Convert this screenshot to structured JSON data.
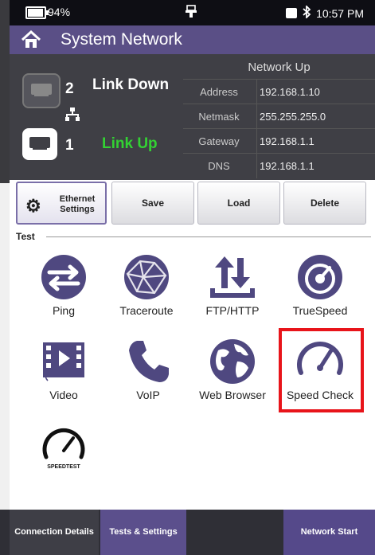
{
  "status_bar": {
    "battery_percent": "94%",
    "battery_level": 0.94,
    "time": "10:57 PM"
  },
  "titlebar": {
    "title": "System Network"
  },
  "ports": [
    {
      "number": "2",
      "status": "Link Down",
      "status_color": "#ffffff"
    },
    {
      "number": "1",
      "status": "Link Up",
      "status_color": "#33d133"
    }
  ],
  "network": {
    "header": "Network Up",
    "rows": [
      {
        "key": "Address",
        "value": "192.168.1.10"
      },
      {
        "key": "Netmask",
        "value": "255.255.255.0"
      },
      {
        "key": "Gateway",
        "value": "192.168.1.1"
      },
      {
        "key": "DNS",
        "value": "192.168.1.1"
      }
    ]
  },
  "buttons": {
    "ethernet_settings": "Ethernet Settings",
    "save": "Save",
    "load": "Load",
    "delete": "Delete"
  },
  "test_section": {
    "label": "Test"
  },
  "tests": [
    {
      "label": "Ping",
      "icon": "ping-icon"
    },
    {
      "label": "Traceroute",
      "icon": "traceroute-icon"
    },
    {
      "label": "FTP/HTTP",
      "icon": "ftp-http-icon"
    },
    {
      "label": "TrueSpeed",
      "icon": "truespeed-icon"
    },
    {
      "label": "Video",
      "icon": "video-icon"
    },
    {
      "label": "VoIP",
      "icon": "voip-icon"
    },
    {
      "label": "Web Browser",
      "icon": "web-browser-icon"
    },
    {
      "label": "Speed Check",
      "icon": "speed-check-icon"
    },
    {
      "label": "",
      "icon": "speedtest-icon",
      "logo_text": "SPEEDTEST"
    }
  ],
  "bottom_tabs": {
    "connection_details": "Connection Details",
    "tests_settings": "Tests & Settings",
    "network_start": "Network Start"
  },
  "colors": {
    "accent": "#5a4f86",
    "icon": "#4f4880",
    "highlight": "#e8141a",
    "link_up": "#33d133"
  }
}
